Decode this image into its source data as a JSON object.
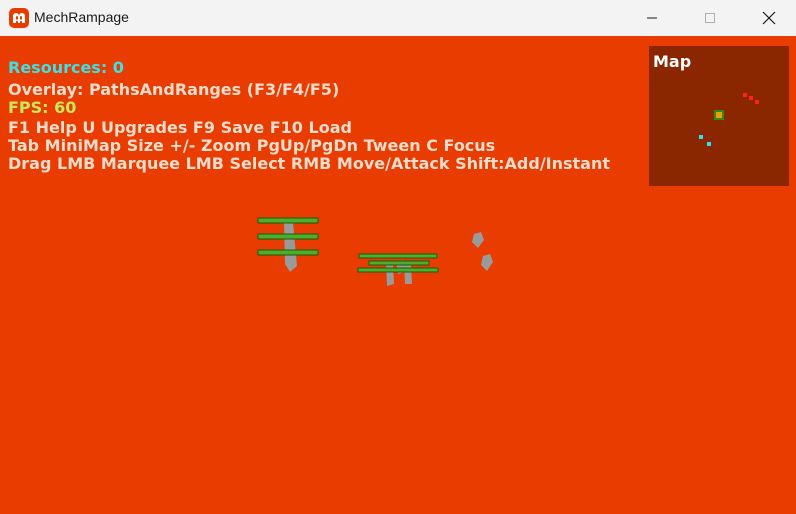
{
  "window": {
    "title": "MechRampage",
    "controls": {
      "minimize_icon": "minimize-icon",
      "maximize_icon": "maximize-icon",
      "close_icon": "close-icon"
    }
  },
  "hud": {
    "resources": "Resources: 0",
    "overlay": "Overlay: PathsAndRanges (F3/F4/F5)",
    "fps": "FPS: 60",
    "keys_line1": "F1 Help  U Upgrades  F9 Save  F10 Load",
    "keys_line2": "Tab MiniMap Size  +/- Zoom  PgUp/PgDn Tween  C Focus",
    "keys_line3": "Drag LMB Marquee  LMB Select  RMB Move/Attack  Shift:Add/Instant"
  },
  "minimap": {
    "title": "Map"
  },
  "colors": {
    "background": "#e83c00",
    "minimap_bg": "#8a2600",
    "resources_text": "#3ee0e8",
    "fps_text": "#c8e85a",
    "hud_text": "#f3dccb",
    "health_bar": "#4caf2a",
    "unit_gray": "#9a9a9a",
    "enemy_dot": "#ff2020",
    "friendly_dot": "#30e0f0"
  }
}
